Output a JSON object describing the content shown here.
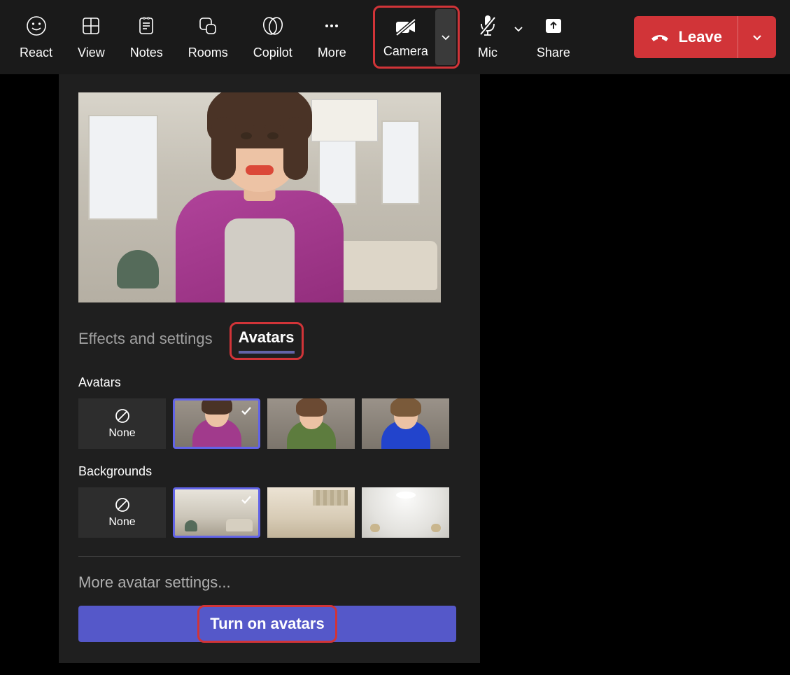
{
  "toolbar": {
    "react": "React",
    "view": "View",
    "notes": "Notes",
    "rooms": "Rooms",
    "copilot": "Copilot",
    "more": "More",
    "camera": "Camera",
    "mic": "Mic",
    "share": "Share",
    "leave": "Leave"
  },
  "popup": {
    "tabs": {
      "effects": "Effects and settings",
      "avatars": "Avatars"
    },
    "sections": {
      "avatars_header": "Avatars",
      "backgrounds_header": "Backgrounds",
      "none": "None"
    },
    "more_settings": "More avatar settings...",
    "turn_on": "Turn on avatars"
  }
}
